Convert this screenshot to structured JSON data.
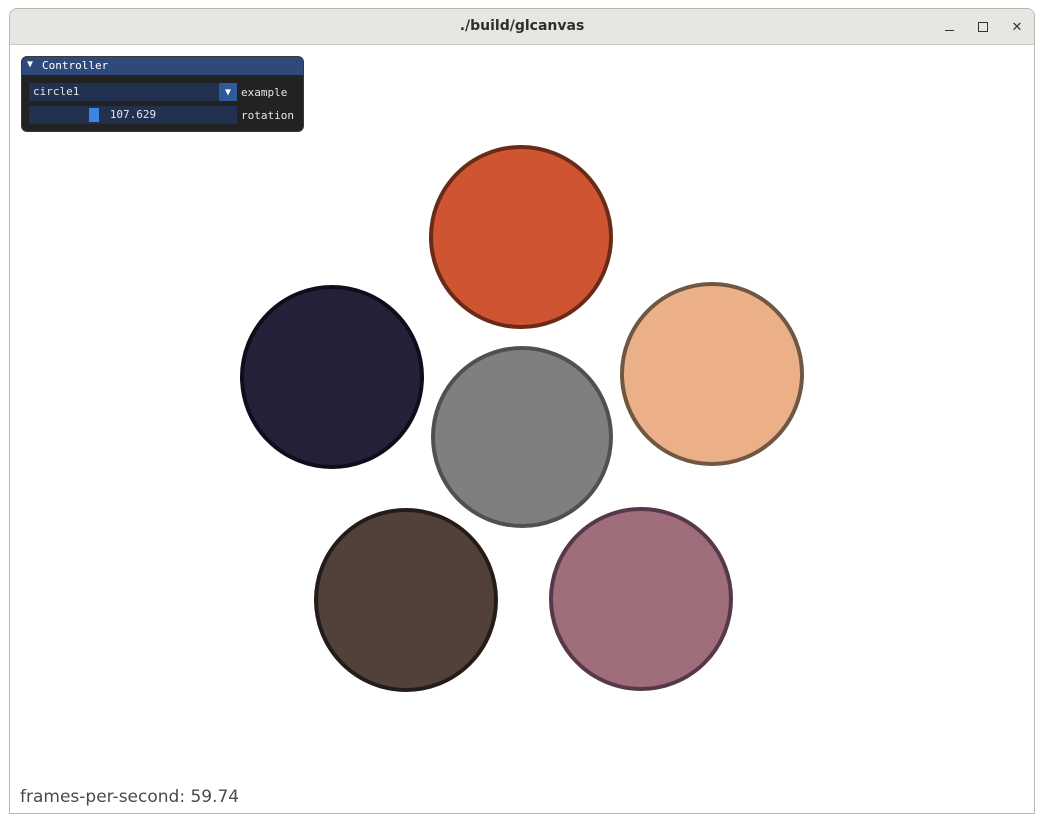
{
  "window": {
    "title": "./build/glcanvas",
    "controls": {
      "minimize": "minimize-icon",
      "maximize": "maximize-icon",
      "close": "close-icon"
    }
  },
  "controller": {
    "title": "Controller",
    "example_value": "circle1",
    "example_label": "example",
    "rotation_value": "107.629",
    "rotation_label": "rotation"
  },
  "scene": {
    "circles": [
      {
        "fill": "#cf5532",
        "stroke": "#6a2a17"
      },
      {
        "fill": "#ecb088",
        "stroke": "#6e5843"
      },
      {
        "fill": "#a06d7a",
        "stroke": "#57384a"
      },
      {
        "fill": "#52413a",
        "stroke": "#241c18"
      },
      {
        "fill": "#251f38",
        "stroke": "#100c1c"
      },
      {
        "fill": "#7f7f7f",
        "stroke": "#505050"
      }
    ]
  },
  "status": {
    "fps_text": "frames-per-second: 59.74"
  }
}
